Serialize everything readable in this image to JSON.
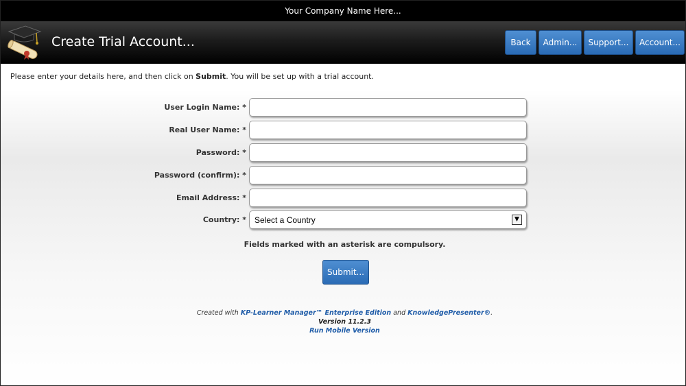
{
  "company_bar": {
    "text": "Your Company Name Here..."
  },
  "header": {
    "title": "Create Trial Account...",
    "logo_icon": "graduation-cap-diploma-icon",
    "nav": {
      "back": "Back",
      "admin": "Admin...",
      "support": "Support...",
      "account": "Account..."
    }
  },
  "intro": {
    "before": "Please enter your details here, and then click on ",
    "bold": "Submit",
    "after": ". You will be set up with a trial account."
  },
  "form": {
    "fields": [
      {
        "label": "User Login Name: *",
        "value": "",
        "placeholder": ""
      },
      {
        "label": "Real User Name: *",
        "value": "",
        "placeholder": ""
      },
      {
        "label": "Password: *",
        "value": "",
        "placeholder": ""
      },
      {
        "label": "Password (confirm): *",
        "value": "",
        "placeholder": ""
      },
      {
        "label": "Email Address: *",
        "value": "",
        "placeholder": ""
      }
    ],
    "country": {
      "label": "Country: *",
      "selected": "Select a Country"
    },
    "compulsory_note": "Fields marked with an asterisk are compulsory.",
    "submit_label": "Submit..."
  },
  "footer": {
    "created_with": "Created with ",
    "product_link": "KP-Learner Manager™ Enterprise Edition",
    "and": " and ",
    "presenter_link": "KnowledgePresenter®",
    "period": ".",
    "version": "Version 11.2.3",
    "mobile_link": "Run Mobile Version"
  },
  "colors": {
    "button_blue": "#2a6bb5",
    "header_black": "#000000",
    "link_blue": "#1f5ca8"
  }
}
